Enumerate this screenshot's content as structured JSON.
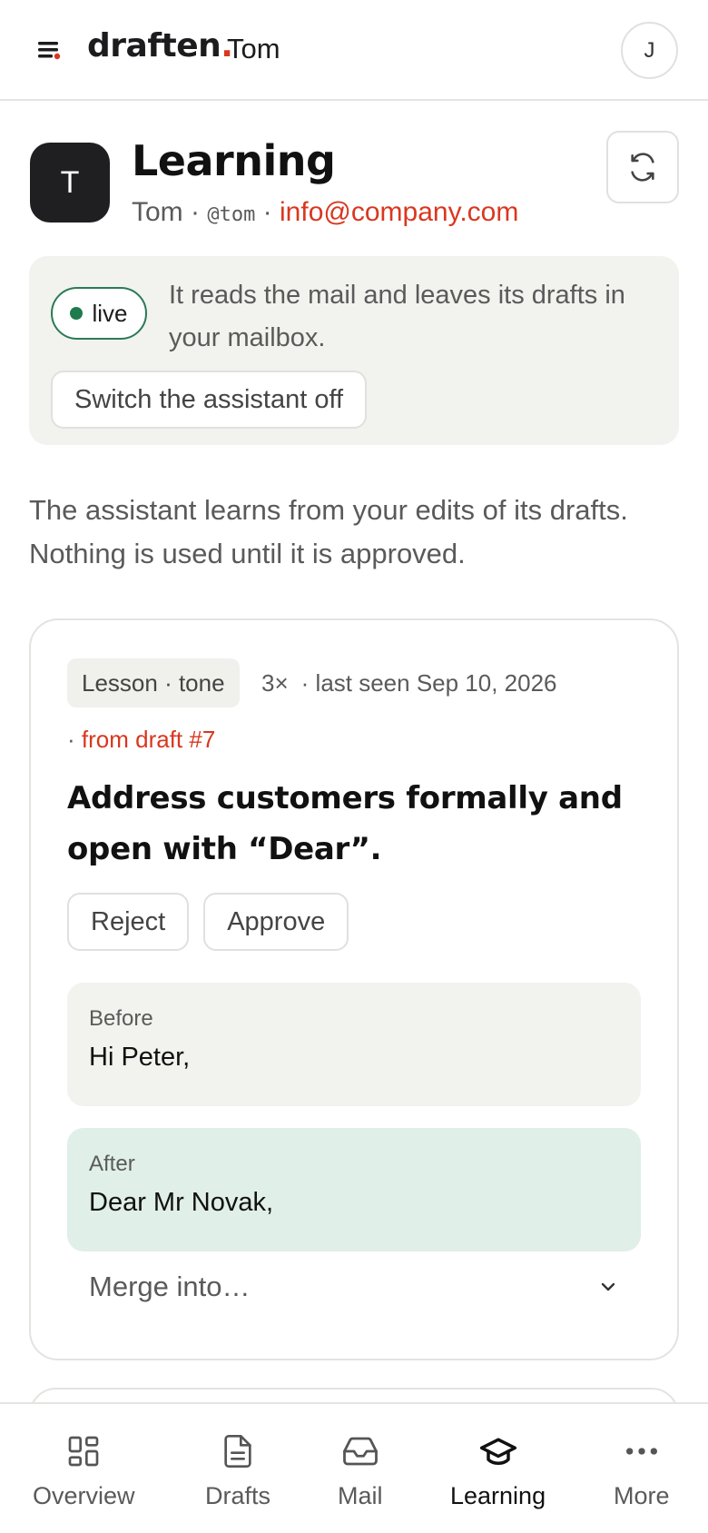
{
  "topbar": {
    "brand_name": "draften",
    "brand_dot": ".",
    "workspace": "Tom",
    "user_initial": "J"
  },
  "header": {
    "avatar_initial": "T",
    "title": "Learning",
    "name": "Tom",
    "sep1": " · ",
    "handle": "@tom",
    "sep2": " · ",
    "email": "info@company.com"
  },
  "status": {
    "badge": "live",
    "description": "It reads the mail and leaves its drafts in your mailbox.",
    "switch_label": "Switch the assistant off"
  },
  "intro": "The assistant learns from your edits of its drafts. Nothing is used until it is approved.",
  "lesson": {
    "tag": "Lesson · tone",
    "count": "3×",
    "last_seen": "· last seen Sep 10, 2026",
    "source_prefix": "· ",
    "source_link": "from draft #7",
    "text": "Address customers formally and open with “Dear”.",
    "reject_label": "Reject",
    "approve_label": "Approve",
    "before_label": "Before",
    "before_value": "Hi Peter,",
    "after_label": "After",
    "after_value": "Dear Mr Novak,",
    "merge_label": "Merge into…"
  },
  "nav": {
    "items": [
      {
        "label": "Overview",
        "icon": "grid-icon"
      },
      {
        "label": "Drafts",
        "icon": "document-icon"
      },
      {
        "label": "Mail",
        "icon": "inbox-icon"
      },
      {
        "label": "Learning",
        "icon": "graduation-cap-icon"
      },
      {
        "label": "More",
        "icon": "more-dots-icon"
      }
    ],
    "active": "Learning"
  },
  "colors": {
    "accent": "#d9371f",
    "live_green": "#1f7a4e",
    "after_bg": "#e0efe8"
  }
}
